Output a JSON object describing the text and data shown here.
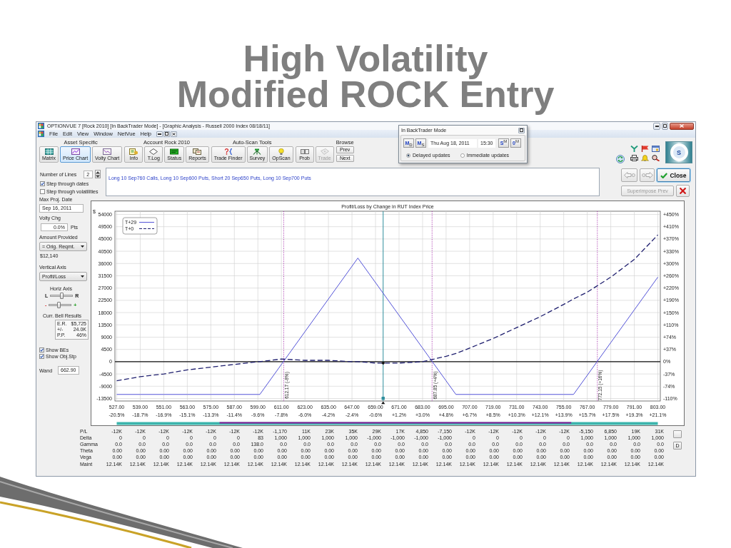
{
  "slide": {
    "title_lines": [
      "High Volatility",
      "Modified ROCK Entry"
    ]
  },
  "window": {
    "title": "OPTIONVUE 7 [Rock 2010] [In BackTrader Mode] - [Graphic Analysis - Russell 2000 Index 08/18/11]"
  },
  "menu": [
    "File",
    "Edit",
    "View",
    "Window",
    "NetVue",
    "Help"
  ],
  "toolbar": {
    "groups": [
      {
        "label": "Asset Specific",
        "buttons": [
          {
            "label": "Matrix",
            "selected": false,
            "disabled": false
          },
          {
            "label": "Price Chart",
            "selected": true,
            "disabled": false
          },
          {
            "label": "Volty Chart",
            "selected": false,
            "disabled": false
          }
        ]
      },
      {
        "label": "Account Rock 2010",
        "buttons": [
          {
            "label": "Info",
            "selected": false,
            "disabled": false
          },
          {
            "label": "T.Log",
            "selected": false,
            "disabled": false
          },
          {
            "label": "Status",
            "selected": false,
            "disabled": false
          },
          {
            "label": "Reports",
            "selected": false,
            "disabled": false
          }
        ]
      },
      {
        "label": "Auto-Scan Tools",
        "buttons": [
          {
            "label": "Trade Finder",
            "selected": false,
            "disabled": false
          },
          {
            "label": "Survey",
            "selected": false,
            "disabled": false
          },
          {
            "label": "OpScan",
            "selected": false,
            "disabled": false
          }
        ]
      },
      {
        "buttons": [
          {
            "label": "Prob",
            "selected": false,
            "disabled": false
          },
          {
            "label": "Trade",
            "selected": false,
            "disabled": true
          }
        ]
      }
    ],
    "browse": {
      "label": "Browse",
      "buttons": [
        "Prev",
        "Next"
      ]
    },
    "logo": "S"
  },
  "backtrader": {
    "title": "In BackTrader Mode",
    "step_buttons_left": [
      "M$_{D}$",
      "M$_{S}$"
    ],
    "date": "Thu Aug 18, 2011",
    "time": "15:30",
    "step_buttons_right": [
      "S$^{M}$",
      "0$^{M}$"
    ],
    "update_modes": [
      {
        "label": "Delayed updates",
        "selected": true
      },
      {
        "label": "Immediate updates",
        "selected": false
      }
    ]
  },
  "settings": {
    "number_of_lines": {
      "label": "Number of Lines",
      "value": "2"
    },
    "step_options": [
      {
        "label": "Step through dates",
        "checked": true
      },
      {
        "label": "Step through volatilities",
        "checked": false
      }
    ],
    "max_proj_date": {
      "label": "Max Proj. Date",
      "value": "Sep 16, 2011"
    },
    "volty_chg": {
      "label": "Volty Chg",
      "value": "0.0%",
      "unit": "Pts"
    },
    "amount_provided": {
      "label": "Amount Provided",
      "value": "= Orig. Reqmt.",
      "amount": "$12,140"
    },
    "vertical_axis": {
      "label": "Vertical Axis",
      "value": "Profit/Loss"
    },
    "horiz_axis": {
      "label": "Horiz Axis",
      "sliders": [
        {
          "kind": "plain",
          "left": "L",
          "right": "R",
          "level": 0.5
        },
        {
          "kind": "signed",
          "left": "-",
          "right": "+",
          "level": 0.45
        }
      ]
    },
    "bell_results": {
      "label": "Curr. Bell Results",
      "rows": [
        {
          "name": "E.R.",
          "value": "$5,725"
        },
        {
          "name": "+/-",
          "value": "24.0K"
        },
        {
          "name": "P.P.",
          "value": "46%"
        }
      ]
    },
    "show_options": [
      {
        "label": "Show BEs",
        "checked": true
      },
      {
        "label": "Show Obj.Stp",
        "checked": true
      }
    ],
    "wand": {
      "label": "Wand",
      "value": "662.90"
    }
  },
  "position": {
    "description": "Long 10 Sep760 Calls, Long 10 Sep600 Puts, Short 20 Sep650 Puts, Long 10 Sep700 Puts",
    "nav_buttons": [
      {
        "disabled": true
      },
      {
        "disabled": true
      }
    ],
    "close_button": "Close",
    "superimpose_button": {
      "label": "Superimpose Prev",
      "disabled": true
    }
  },
  "chart": {
    "chart_data": {
      "type": "line",
      "title": "Profit/Loss by Change in RUT Index Price",
      "ylabel": "$",
      "x": [
        527,
        539,
        551,
        563,
        575,
        587,
        599,
        600,
        611,
        623,
        635,
        647,
        650,
        659,
        671,
        683,
        695,
        700,
        707,
        719,
        731,
        743,
        755,
        760,
        767,
        779,
        791,
        803
      ],
      "series": [
        {
          "name": "T+29",
          "color": "#5353d8",
          "line_style": "solid",
          "values": [
            -12000,
            -12000,
            -12000,
            -12000,
            -12000,
            -12000,
            -12000,
            -12000,
            -1000,
            11000,
            23000,
            35000,
            38000,
            29000,
            17000,
            5000,
            -7000,
            -12000,
            -12000,
            -12000,
            -12000,
            -12000,
            -12000,
            -12000,
            -5000,
            7000,
            19000,
            31000
          ]
        },
        {
          "name": "T+0",
          "color": "#1e1e6e",
          "line_style": "dashed",
          "values": [
            -7000,
            -5500,
            -4500,
            -3000,
            -2000,
            -1000,
            0,
            0,
            1000,
            500,
            500,
            0,
            0,
            -500,
            -500,
            0,
            2000,
            3000,
            5000,
            8500,
            12500,
            16500,
            21000,
            23000,
            25500,
            31000,
            37500,
            46500
          ]
        }
      ],
      "xlim": [
        527,
        803
      ],
      "ylim": [
        -13500,
        54000
      ],
      "xticks": [
        {
          "value": 527,
          "label": "527.00"
        },
        {
          "value": 539,
          "label": "539.00"
        },
        {
          "value": 551,
          "label": "551.00"
        },
        {
          "value": 563,
          "label": "563.00"
        },
        {
          "value": 575,
          "label": "575.00"
        },
        {
          "value": 587,
          "label": "587.00"
        },
        {
          "value": 599,
          "label": "599.00"
        },
        {
          "value": 611,
          "label": "611.00"
        },
        {
          "value": 623,
          "label": "623.00"
        },
        {
          "value": 635,
          "label": "635.00"
        },
        {
          "value": 647,
          "label": "647.00"
        },
        {
          "value": 659,
          "label": "659.00"
        },
        {
          "value": 671,
          "label": "671.00"
        },
        {
          "value": 683,
          "label": "683.00"
        },
        {
          "value": 695,
          "label": "695.00"
        },
        {
          "value": 707,
          "label": "707.00"
        },
        {
          "value": 719,
          "label": "719.00"
        },
        {
          "value": 731,
          "label": "731.00"
        },
        {
          "value": 743,
          "label": "743.00"
        },
        {
          "value": 755,
          "label": "755.00"
        },
        {
          "value": 767,
          "label": "767.00"
        },
        {
          "value": 779,
          "label": "779.00"
        },
        {
          "value": 791,
          "label": "791.00"
        },
        {
          "value": 803,
          "label": "803.00"
        }
      ],
      "yticks": [
        54000,
        49500,
        45000,
        40500,
        36000,
        31500,
        27000,
        22500,
        18000,
        13500,
        9000,
        4500,
        0,
        -4500,
        -9000,
        -13500
      ],
      "grid": true,
      "legend": "upper left",
      "ref_lines": [
        {
          "axis": "x",
          "value": 612.17,
          "label": "612.17 (-8%)",
          "color": "#a326a8",
          "line_style": "dotted"
        },
        {
          "axis": "x",
          "value": 687.85,
          "label": "687.85 (+4%)",
          "color": "#a326a8",
          "line_style": "dotted"
        },
        {
          "axis": "x",
          "value": 772.15,
          "label": "772.15 (+16%)",
          "color": "#a326a8",
          "line_style": "dotted"
        },
        {
          "axis": "x",
          "value": 662.9,
          "color": "#2f8f9d",
          "line_style": "solid"
        }
      ]
    },
    "right_axis_labels": [
      "+450%",
      "+410%",
      "+370%",
      "+330%",
      "+300%",
      "+260%",
      "+220%",
      "+190%",
      "+150%",
      "+110%",
      "+74%",
      "+37%",
      "0%",
      "-37%",
      "-74%",
      "-110%"
    ],
    "change_labels": [
      "-20.5%",
      "-18.7%",
      "-16.9%",
      "-15.1%",
      "-13.3%",
      "-11.4%",
      "-9.6%",
      "-7.8%",
      "-6.0%",
      "-4.2%",
      "-2.4%",
      "-0.6%",
      "+1.2%",
      "+3.0%",
      "+4.8%",
      "+6.7%",
      "+8.5%",
      "+10.3%",
      "+12.1%",
      "+13.9%",
      "+15.7%",
      "+17.5%",
      "+19.3%",
      "+21.1%"
    ]
  },
  "table": {
    "rows": [
      {
        "name": "P/L",
        "cells": [
          "-12K",
          "-12K",
          "-12K",
          "-12K",
          "-12K",
          "-12K",
          "-12K",
          "-1,170",
          "11K",
          "23K",
          "35K",
          "29K",
          "17K",
          "4,850",
          "-7,150",
          "-12K",
          "-12K",
          "-12K",
          "-12K",
          "-12K",
          "-5,150",
          "6,850",
          "19K",
          "31K"
        ]
      },
      {
        "name": "Delta",
        "cells": [
          "0",
          "0",
          "0",
          "0",
          "0",
          "0",
          "83",
          "1,000",
          "1,000",
          "1,000",
          "1,000",
          "-1,000",
          "-1,000",
          "-1,000",
          "-1,000",
          "0",
          "0",
          "0",
          "0",
          "0",
          "1,000",
          "1,000",
          "1,000",
          "1,000"
        ]
      },
      {
        "name": "Gamma",
        "cells": [
          "0.0",
          "0.0",
          "0.0",
          "0.0",
          "0.0",
          "0.0",
          "138.0",
          "0.0",
          "0.0",
          "0.0",
          "0.0",
          "0.0",
          "0.0",
          "0.0",
          "0.0",
          "0.0",
          "0.0",
          "0.0",
          "0.0",
          "0.0",
          "0.0",
          "0.0",
          "0.0",
          "0.0"
        ]
      },
      {
        "name": "Theta",
        "cells": [
          "0.00",
          "0.00",
          "0.00",
          "0.00",
          "0.00",
          "0.00",
          "0.00",
          "0.00",
          "0.00",
          "0.00",
          "0.00",
          "0.00",
          "0.00",
          "0.00",
          "0.00",
          "0.00",
          "0.00",
          "0.00",
          "0.00",
          "0.00",
          "0.00",
          "0.00",
          "0.00",
          "0.00"
        ]
      },
      {
        "name": "Vega",
        "cells": [
          "0.00",
          "0.00",
          "0.00",
          "0.00",
          "0.00",
          "0.00",
          "0.00",
          "0.00",
          "0.00",
          "0.00",
          "0.00",
          "0.00",
          "0.00",
          "0.00",
          "0.00",
          "0.00",
          "0.00",
          "0.00",
          "0.00",
          "0.00",
          "0.00",
          "0.00",
          "0.00",
          "0.00"
        ]
      },
      {
        "name": "Maint",
        "cells": [
          "12.14K",
          "12.14K",
          "12.14K",
          "12.14K",
          "12.14K",
          "12.14K",
          "12.14K",
          "12.14K",
          "12.14K",
          "12.14K",
          "12.14K",
          "12.14K",
          "12.14K",
          "12.14K",
          "12.14K",
          "12.14K",
          "12.14K",
          "12.14K",
          "12.14K",
          "12.14K",
          "12.14K",
          "12.14K",
          "12.14K",
          "12.14K"
        ]
      }
    ],
    "buttons": [
      "D"
    ]
  }
}
